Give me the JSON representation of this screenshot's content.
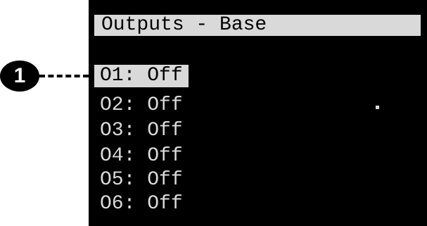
{
  "screen": {
    "title": "Outputs - Base",
    "outputs": [
      {
        "label": "O1: Off",
        "selected": true
      },
      {
        "label": "O2: Off",
        "selected": false
      },
      {
        "label": "O3: Off",
        "selected": false
      },
      {
        "label": "O4: Off",
        "selected": false
      },
      {
        "label": "O5: Off",
        "selected": false
      },
      {
        "label": "O6: Off",
        "selected": false
      }
    ]
  },
  "callout": {
    "number": "1"
  },
  "colors": {
    "screen_background": "#000000",
    "text": "#d9d9d9",
    "highlight": "#d9d9d9",
    "highlight_text": "#000000"
  }
}
